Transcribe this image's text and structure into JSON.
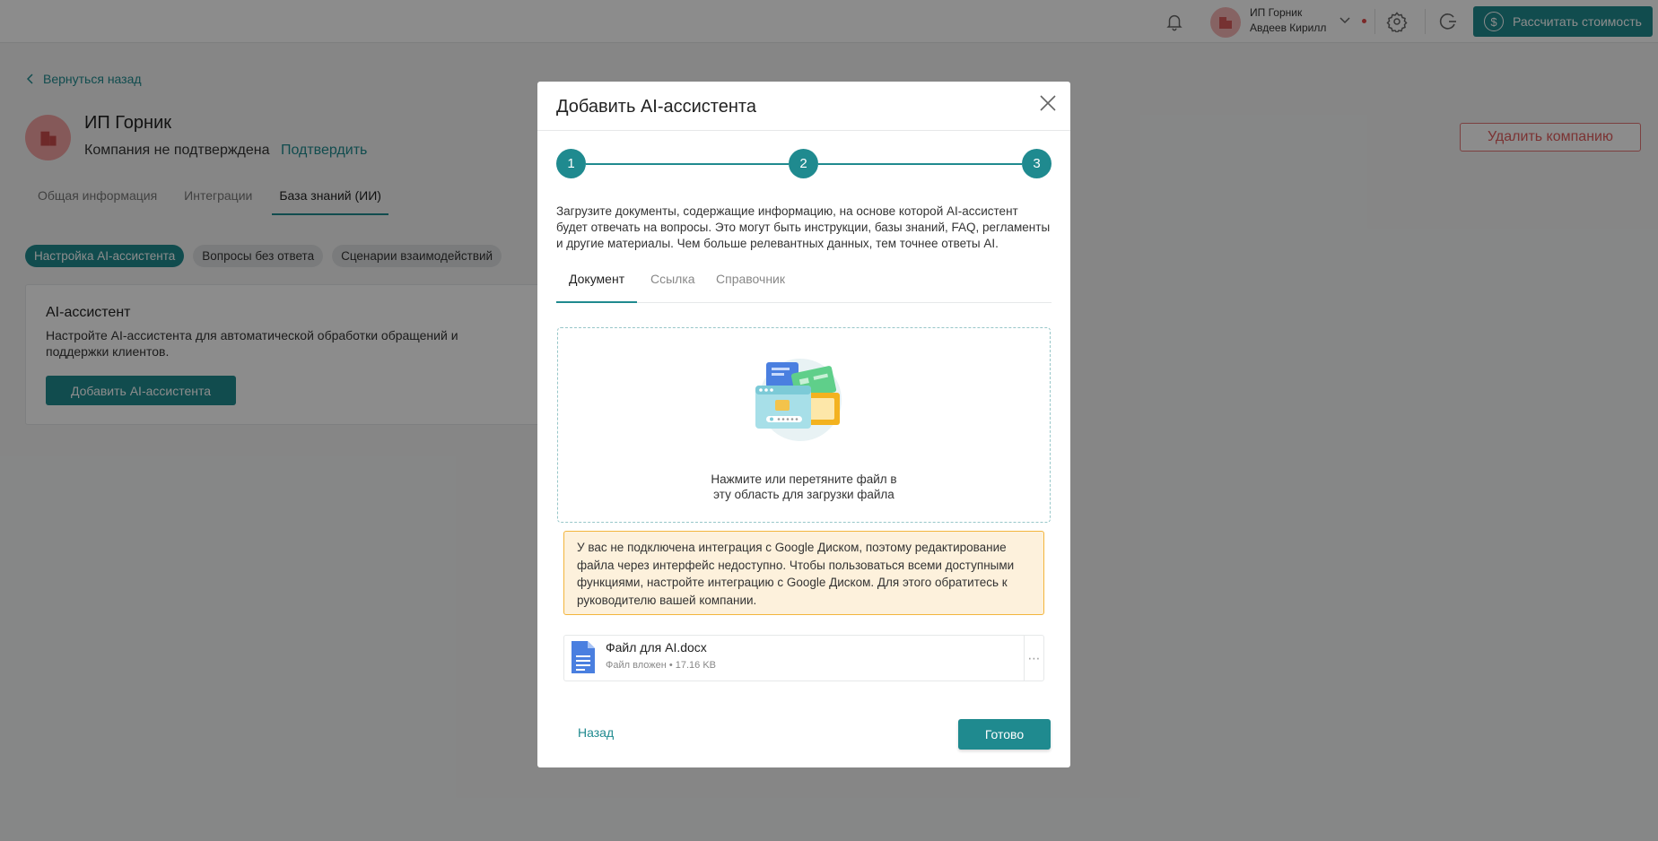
{
  "header": {
    "user_line1": "ИП Горник",
    "user_line2": "Авдеев Кирилл",
    "calc_button": "Рассчитать стоимость",
    "accent_color": "#1f8a8f"
  },
  "page": {
    "back_link": "Вернуться назад",
    "company_name": "ИП Горник",
    "company_status": "Компания не подтверждена",
    "confirm_link": "Подтвердить",
    "delete_button": "Удалить компанию",
    "tabs": [
      "Общая информация",
      "Интеграции",
      "База знаний (ИИ)"
    ],
    "chips": [
      "Настройка AI-ассистента",
      "Вопросы без ответа",
      "Сценарии взаимодействий"
    ],
    "card": {
      "title": "AI-ассистент",
      "description": "Настройте AI-ассистента для автоматической обработки обращений и поддержки клиентов.",
      "button": "Добавить AI-ассистента"
    }
  },
  "modal": {
    "title": "Добавить AI-ассистента",
    "steps": [
      "1",
      "2",
      "3"
    ],
    "description": "Загрузите документы, содержащие информацию, на основе которой AI-ассистент будет отвечать на вопросы. Это могут быть инструкции, базы знаний, FAQ, регламенты и другие материалы. Чем больше релевантных данных, тем точнее ответы AI.",
    "tabs": [
      "Документ",
      "Ссылка",
      "Справочник"
    ],
    "dropzone_line1": "Нажмите или перетяните файл в",
    "dropzone_line2": "эту область для загрузки файла",
    "warning": "У вас не подключена интеграция с Google Диском, поэтому редактирование файла через интерфейс недоступно. Чтобы пользоваться всеми доступными функциями, настройте интеграцию с Google Диском. Для этого обратитесь к руководителю вашей компании.",
    "file": {
      "name": "Файл для AI.docx",
      "meta": "Файл вложен • 17.16 KB"
    },
    "back_button": "Назад",
    "done_button": "Готово"
  }
}
